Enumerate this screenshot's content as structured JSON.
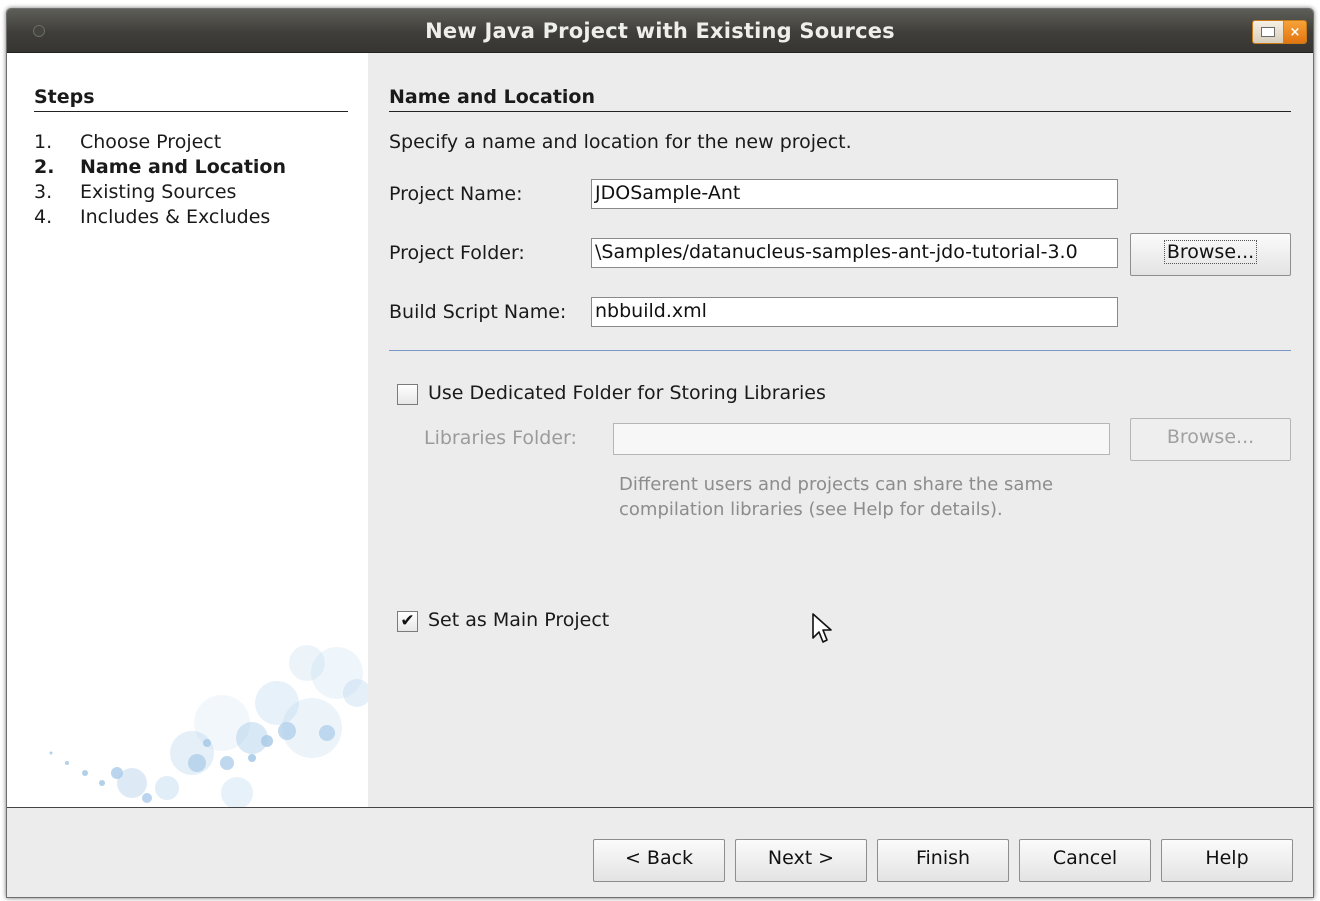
{
  "window": {
    "title": "New Java Project with Existing Sources"
  },
  "steps": {
    "heading": "Steps",
    "items": [
      {
        "num": "1.",
        "label": "Choose Project"
      },
      {
        "num": "2.",
        "label": "Name and Location"
      },
      {
        "num": "3.",
        "label": "Existing Sources"
      },
      {
        "num": "4.",
        "label": "Includes & Excludes"
      }
    ]
  },
  "panel": {
    "heading": "Name and Location",
    "description": "Specify a name and location for the new project.",
    "project_name": {
      "label": "Project Name:",
      "value": "JDOSample-Ant"
    },
    "project_folder": {
      "label": "Project Folder:",
      "value": "\\Samples/datanucleus-samples-ant-jdo-tutorial-3.0",
      "browse": "Browse..."
    },
    "build_script": {
      "label": "Build Script Name:",
      "value": "nbbuild.xml"
    },
    "dedicated_folder": {
      "label": "Use Dedicated Folder for Storing Libraries",
      "checked": false
    },
    "libraries_folder": {
      "label": "Libraries Folder:",
      "value": "",
      "browse": "Browse..."
    },
    "note": "Different users and projects can share the same compilation libraries (see Help for details).",
    "main_project": {
      "label": "Set as Main Project",
      "checked": true
    }
  },
  "buttons": {
    "back": "< Back",
    "next": "Next >",
    "finish": "Finish",
    "cancel": "Cancel",
    "help": "Help"
  }
}
